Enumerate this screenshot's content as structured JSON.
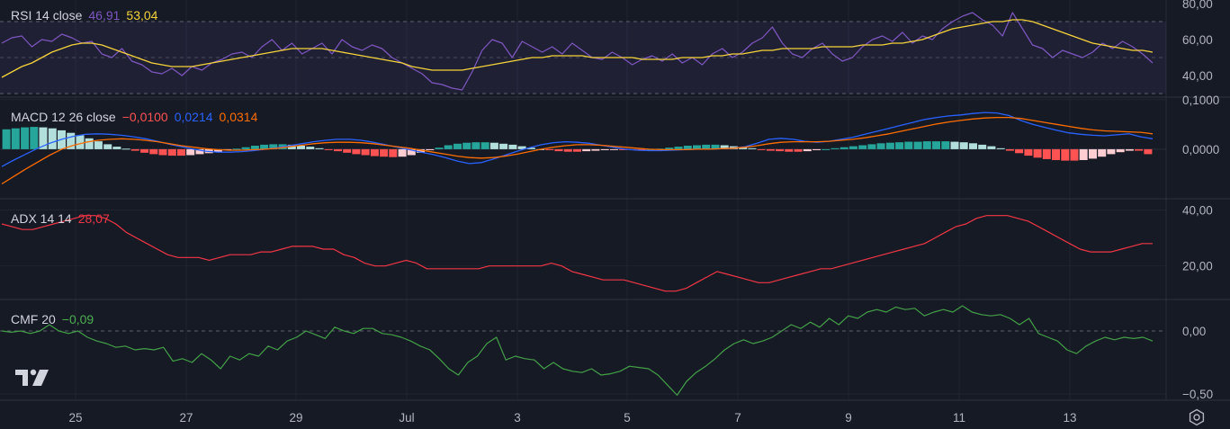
{
  "x_axis": {
    "labels": [
      "25",
      "27",
      "29",
      "Jul",
      "3",
      "5",
      "7",
      "9",
      "11",
      "13"
    ]
  },
  "colors": {
    "background": "#161a25",
    "rsi": "#7e57c2",
    "rsi_ma": "#f5d33b",
    "macd": "#2962ff",
    "signal": "#ff6d00",
    "hist_pos_strong": "#26a69a",
    "hist_pos_weak": "#b2dfdb",
    "hist_neg_strong": "#ff5252",
    "hist_neg_weak": "#ffcdd2",
    "adx": "#f23645",
    "cmf": "#43a047"
  },
  "panes": {
    "rsi": {
      "name": "RSI 14 close",
      "value": "46,91",
      "ma_value": "53,04",
      "axis_labels": [
        "80,00",
        "60,00",
        "40,00"
      ]
    },
    "macd": {
      "name": "MACD 12 26 close",
      "hist_value": "−0,0100",
      "macd_value": "0,0214",
      "signal_value": "0,0314",
      "axis_labels": [
        "0,1000",
        "0,0000"
      ]
    },
    "adx": {
      "name": "ADX 14 14",
      "value": "28,07",
      "axis_labels": [
        "40,00",
        "20,00"
      ]
    },
    "cmf": {
      "name": "CMF 20",
      "value": "−0,09",
      "axis_labels": [
        "0,00",
        "−0,50"
      ]
    }
  },
  "chart_data": [
    {
      "type": "line",
      "indicator": "RSI 14 close",
      "x_ticks": [
        "25",
        "27",
        "29",
        "Jul",
        "3",
        "5",
        "7",
        "9",
        "11",
        "13"
      ],
      "ylim": [
        28,
        82
      ],
      "bands": [
        30,
        50,
        70
      ],
      "series": [
        {
          "name": "RSI",
          "values": [
            58,
            61,
            62,
            56,
            60,
            59,
            63,
            61,
            58,
            59,
            52,
            50,
            55,
            48,
            46,
            42,
            41,
            44,
            40,
            45,
            43,
            47,
            49,
            52,
            53,
            50,
            56,
            60,
            54,
            58,
            52,
            55,
            58,
            52,
            60,
            56,
            54,
            57,
            55,
            50,
            47,
            44,
            41,
            36,
            35,
            33,
            32,
            42,
            54,
            60,
            58,
            50,
            59,
            56,
            53,
            56,
            52,
            58,
            54,
            50,
            49,
            53,
            50,
            46,
            49,
            51,
            48,
            52,
            47,
            50,
            46,
            52,
            55,
            50,
            53,
            58,
            61,
            67,
            58,
            52,
            50,
            55,
            58,
            52,
            48,
            50,
            56,
            60,
            62,
            59,
            64,
            58,
            62,
            60,
            66,
            70,
            73,
            75,
            71,
            68,
            62,
            75,
            66,
            57,
            55,
            50,
            54,
            52,
            50,
            53,
            58,
            55,
            59,
            56,
            52,
            47
          ]
        },
        {
          "name": "MA",
          "values": [
            39,
            42,
            45,
            47,
            50,
            53,
            55,
            57,
            58,
            58,
            57,
            55,
            53,
            51,
            49,
            47,
            46,
            45,
            45,
            45,
            46,
            47,
            48,
            49,
            50,
            51,
            52,
            53,
            54,
            55,
            55,
            55,
            55,
            54,
            53,
            52,
            51,
            50,
            49,
            48,
            47,
            45,
            44,
            43,
            43,
            43,
            43,
            44,
            45,
            46,
            47,
            48,
            49,
            50,
            50,
            51,
            51,
            51,
            51,
            50,
            50,
            50,
            50,
            50,
            49,
            49,
            49,
            49,
            50,
            50,
            50,
            51,
            51,
            52,
            52,
            53,
            54,
            54,
            55,
            55,
            55,
            55,
            56,
            56,
            56,
            56,
            57,
            57,
            57,
            58,
            58,
            59,
            60,
            62,
            64,
            66,
            67,
            68,
            69,
            70,
            70,
            71,
            71,
            70,
            68,
            66,
            64,
            62,
            60,
            58,
            57,
            56,
            55,
            54,
            54,
            53
          ]
        }
      ]
    },
    {
      "type": "bar",
      "indicator": "MACD 12 26 close",
      "x_ticks": [
        "25",
        "27",
        "29",
        "Jul",
        "3",
        "5",
        "7",
        "9",
        "11",
        "13"
      ],
      "ylim": [
        -0.1,
        0.105
      ],
      "series": [
        {
          "name": "Histogram",
          "values": [
            0.04,
            0.042,
            0.044,
            0.045,
            0.044,
            0.042,
            0.038,
            0.033,
            0.028,
            0.022,
            0.016,
            0.01,
            0.005,
            0.001,
            -0.003,
            -0.007,
            -0.01,
            -0.012,
            -0.013,
            -0.013,
            -0.012,
            -0.01,
            -0.008,
            -0.005,
            -0.002,
            0.001,
            0.004,
            0.007,
            0.009,
            0.01,
            0.01,
            0.009,
            0.007,
            0.005,
            0.002,
            -0.001,
            -0.004,
            -0.007,
            -0.01,
            -0.012,
            -0.014,
            -0.015,
            -0.016,
            -0.015,
            -0.012,
            -0.007,
            -0.002,
            0.003,
            0.008,
            0.011,
            0.013,
            0.014,
            0.014,
            0.013,
            0.011,
            0.009,
            0.006,
            0.003,
            0.0,
            -0.002,
            -0.004,
            -0.005,
            -0.005,
            -0.004,
            -0.003,
            -0.002,
            -0.001,
            -0.001,
            -0.001,
            -0.001,
            0.0,
            0.001,
            0.003,
            0.005,
            0.007,
            0.008,
            0.009,
            0.009,
            0.008,
            0.006,
            0.004,
            0.002,
            -0.001,
            -0.003,
            -0.004,
            -0.005,
            -0.005,
            -0.004,
            -0.002,
            0.0,
            0.002,
            0.004,
            0.006,
            0.008,
            0.01,
            0.012,
            0.013,
            0.014,
            0.015,
            0.015,
            0.016,
            0.016,
            0.016,
            0.015,
            0.014,
            0.012,
            0.009,
            0.006,
            0.002,
            -0.003,
            -0.008,
            -0.013,
            -0.017,
            -0.02,
            -0.022,
            -0.023,
            -0.023,
            -0.022,
            -0.019,
            -0.015,
            -0.01,
            -0.006,
            -0.003,
            -0.003,
            -0.01
          ]
        },
        {
          "name": "MACD",
          "values": [
            -0.035,
            -0.022,
            -0.01,
            0.002,
            0.012,
            0.02,
            0.026,
            0.03,
            0.031,
            0.03,
            0.028,
            0.025,
            0.021,
            0.016,
            0.01,
            0.005,
            0.0,
            -0.004,
            -0.006,
            -0.006,
            -0.005,
            -0.003,
            0.0,
            0.003,
            0.007,
            0.011,
            0.015,
            0.018,
            0.02,
            0.02,
            0.018,
            0.014,
            0.009,
            0.004,
            -0.001,
            -0.006,
            -0.011,
            -0.017,
            -0.024,
            -0.029,
            -0.027,
            -0.02,
            -0.012,
            -0.004,
            0.003,
            0.009,
            0.013,
            0.015,
            0.014,
            0.012,
            0.008,
            0.004,
            0.0,
            -0.002,
            -0.003,
            -0.003,
            -0.002,
            -0.001,
            0.0,
            0.0,
            0.001,
            0.002,
            0.005,
            0.012,
            0.02,
            0.022,
            0.02,
            0.016,
            0.014,
            0.016,
            0.02,
            0.024,
            0.03,
            0.036,
            0.042,
            0.048,
            0.054,
            0.06,
            0.064,
            0.067,
            0.069,
            0.072,
            0.074,
            0.073,
            0.068,
            0.058,
            0.05,
            0.044,
            0.038,
            0.033,
            0.03,
            0.028,
            0.027,
            0.029,
            0.031,
            0.025,
            0.021
          ]
        },
        {
          "name": "Signal",
          "values": [
            -0.07,
            -0.055,
            -0.04,
            -0.026,
            -0.012,
            0.0,
            0.008,
            0.014,
            0.018,
            0.02,
            0.021,
            0.02,
            0.018,
            0.015,
            0.011,
            0.007,
            0.004,
            0.001,
            -0.001,
            -0.002,
            -0.002,
            -0.001,
            0.0,
            0.002,
            0.005,
            0.008,
            0.011,
            0.013,
            0.014,
            0.014,
            0.013,
            0.011,
            0.008,
            0.005,
            0.002,
            -0.002,
            -0.006,
            -0.01,
            -0.014,
            -0.017,
            -0.018,
            -0.017,
            -0.014,
            -0.01,
            -0.005,
            0.0,
            0.004,
            0.007,
            0.009,
            0.009,
            0.008,
            0.006,
            0.004,
            0.002,
            0.0,
            -0.001,
            -0.001,
            -0.001,
            0.0,
            0.0,
            0.001,
            0.002,
            0.004,
            0.007,
            0.011,
            0.014,
            0.015,
            0.015,
            0.015,
            0.016,
            0.018,
            0.02,
            0.023,
            0.027,
            0.031,
            0.036,
            0.041,
            0.046,
            0.051,
            0.055,
            0.058,
            0.061,
            0.063,
            0.064,
            0.064,
            0.062,
            0.058,
            0.054,
            0.05,
            0.046,
            0.042,
            0.039,
            0.037,
            0.036,
            0.035,
            0.034,
            0.031
          ]
        }
      ]
    },
    {
      "type": "line",
      "indicator": "ADX 14 14",
      "x_ticks": [
        "25",
        "27",
        "29",
        "Jul",
        "3",
        "5",
        "7",
        "9",
        "11",
        "13"
      ],
      "ylim": [
        8,
        44
      ],
      "series": [
        {
          "name": "ADX",
          "values": [
            35,
            34,
            33,
            33,
            34,
            35,
            36,
            37,
            38,
            38,
            37,
            35,
            32,
            30,
            28,
            26,
            24,
            23,
            23,
            23,
            22,
            23,
            24,
            24,
            24,
            25,
            25,
            26,
            27,
            27,
            27,
            26,
            26,
            24,
            23,
            21,
            20,
            20,
            21,
            22,
            21,
            19,
            19,
            19,
            19,
            19,
            19,
            20,
            20,
            20,
            20,
            20,
            20,
            21,
            20,
            18,
            17,
            16,
            15,
            15,
            15,
            14,
            13,
            12,
            11,
            11,
            12,
            14,
            16,
            18,
            17,
            16,
            15,
            14,
            14,
            15,
            16,
            17,
            18,
            19,
            19,
            20,
            21,
            22,
            23,
            24,
            25,
            26,
            27,
            28,
            30,
            32,
            34,
            35,
            37,
            38,
            38,
            38,
            37,
            36,
            34,
            32,
            30,
            28,
            26,
            25,
            25,
            25,
            26,
            27,
            28,
            28
          ]
        }
      ]
    },
    {
      "type": "line",
      "indicator": "CMF 20",
      "x_ticks": [
        "25",
        "27",
        "29",
        "Jul",
        "3",
        "5",
        "7",
        "9",
        "11",
        "13"
      ],
      "ylim": [
        -0.55,
        0.25
      ],
      "series": [
        {
          "name": "CMF",
          "values": [
            0.0,
            -0.01,
            0.0,
            -0.02,
            0.0,
            0.05,
            0.0,
            -0.02,
            0.0,
            -0.05,
            -0.08,
            -0.1,
            -0.13,
            -0.12,
            -0.15,
            -0.14,
            -0.15,
            -0.13,
            -0.24,
            -0.22,
            -0.25,
            -0.18,
            -0.23,
            -0.3,
            -0.2,
            -0.23,
            -0.18,
            -0.2,
            -0.12,
            -0.15,
            -0.08,
            -0.05,
            0.0,
            -0.03,
            -0.06,
            0.03,
            0.0,
            -0.02,
            0.02,
            0.02,
            -0.02,
            -0.03,
            -0.05,
            -0.08,
            -0.12,
            -0.15,
            -0.22,
            -0.3,
            -0.35,
            -0.25,
            -0.2,
            -0.1,
            -0.05,
            -0.23,
            -0.2,
            -0.22,
            -0.23,
            -0.3,
            -0.25,
            -0.3,
            -0.32,
            -0.33,
            -0.3,
            -0.35,
            -0.34,
            -0.32,
            -0.28,
            -0.29,
            -0.3,
            -0.35,
            -0.43,
            -0.51,
            -0.4,
            -0.33,
            -0.28,
            -0.22,
            -0.15,
            -0.1,
            -0.07,
            -0.1,
            -0.08,
            -0.05,
            0.0,
            0.05,
            0.02,
            0.07,
            0.03,
            0.1,
            0.05,
            0.12,
            0.1,
            0.15,
            0.17,
            0.15,
            0.19,
            0.17,
            0.18,
            0.12,
            0.15,
            0.17,
            0.15,
            0.2,
            0.15,
            0.13,
            0.12,
            0.13,
            0.1,
            0.05,
            0.1,
            -0.02,
            -0.05,
            -0.08,
            -0.15,
            -0.18,
            -0.12,
            -0.08,
            -0.05,
            -0.07,
            -0.05,
            -0.06,
            -0.05,
            -0.08
          ]
        }
      ]
    }
  ]
}
